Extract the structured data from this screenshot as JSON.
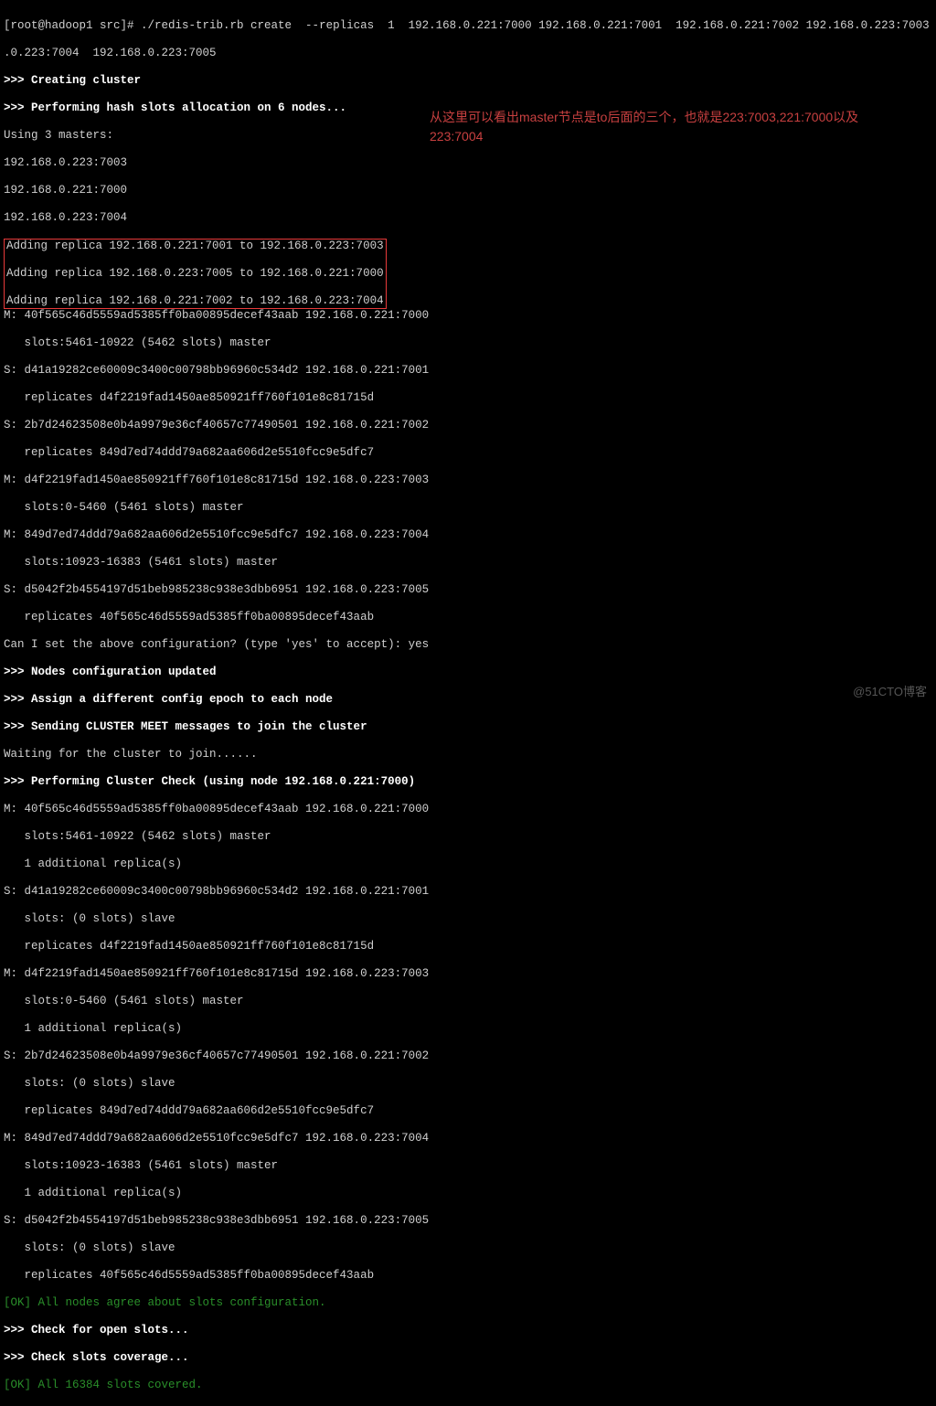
{
  "prompt": "[root@hadoop1 src]# ",
  "command": "./redis-trib.rb create  --replicas  1  192.168.0.221:7000 192.168.0.221:7001  192.168.0.221:7002 192.168.0.223:7003  192.168",
  "command2": ".0.223:7004  192.168.0.223:7005",
  "l_creating": ">>> Creating cluster",
  "l_perform": ">>> Performing hash slots allocation on 6 nodes...",
  "l_using": "Using 3 masters:",
  "l_m1": "192.168.0.223:7003",
  "l_m2": "192.168.0.221:7000",
  "l_m3": "192.168.0.223:7004",
  "box1": "Adding replica 192.168.0.221:7001 to 192.168.0.223:7003",
  "box2": "Adding replica 192.168.0.223:7005 to 192.168.0.221:7000",
  "box3": "Adding replica 192.168.0.221:7002 to 192.168.0.223:7004",
  "n1a": "M: 40f565c46d5559ad5385ff0ba00895decef43aab 192.168.0.221:7000",
  "n1b": "   slots:5461-10922 (5462 slots) master",
  "n2a": "S: d41a19282ce60009c3400c00798bb96960c534d2 192.168.0.221:7001",
  "n2b": "   replicates d4f2219fad1450ae850921ff760f101e8c81715d",
  "n3a": "S: 2b7d24623508e0b4a9979e36cf40657c77490501 192.168.0.221:7002",
  "n3b": "   replicates 849d7ed74ddd79a682aa606d2e5510fcc9e5dfc7",
  "n4a": "M: d4f2219fad1450ae850921ff760f101e8c81715d 192.168.0.223:7003",
  "n4b": "   slots:0-5460 (5461 slots) master",
  "n5a": "M: 849d7ed74ddd79a682aa606d2e5510fcc9e5dfc7 192.168.0.223:7004",
  "n5b": "   slots:10923-16383 (5461 slots) master",
  "n6a": "S: d5042f2b4554197d51beb985238c938e3dbb6951 192.168.0.223:7005",
  "n6b": "   replicates 40f565c46d5559ad5385ff0ba00895decef43aab",
  "l_can": "Can I set the above configuration? (type 'yes' to accept): yes",
  "l_upd": ">>> Nodes configuration updated",
  "l_assign": ">>> Assign a different config epoch to each node",
  "l_send": ">>> Sending CLUSTER MEET messages to join the cluster",
  "l_wait": "Waiting for the cluster to join......",
  "l_check": ">>> Performing Cluster Check (using node 192.168.0.221:7000)",
  "c1a": "M: 40f565c46d5559ad5385ff0ba00895decef43aab 192.168.0.221:7000",
  "c1b": "   slots:5461-10922 (5462 slots) master",
  "c1c": "   1 additional replica(s)",
  "c2a": "S: d41a19282ce60009c3400c00798bb96960c534d2 192.168.0.221:7001",
  "c2b": "   slots: (0 slots) slave",
  "c2c": "   replicates d4f2219fad1450ae850921ff760f101e8c81715d",
  "c3a": "M: d4f2219fad1450ae850921ff760f101e8c81715d 192.168.0.223:7003",
  "c3b": "   slots:0-5460 (5461 slots) master",
  "c3c": "   1 additional replica(s)",
  "c4a": "S: 2b7d24623508e0b4a9979e36cf40657c77490501 192.168.0.221:7002",
  "c4b": "   slots: (0 slots) slave",
  "c4c": "   replicates 849d7ed74ddd79a682aa606d2e5510fcc9e5dfc7",
  "c5a": "M: 849d7ed74ddd79a682aa606d2e5510fcc9e5dfc7 192.168.0.223:7004",
  "c5b": "   slots:10923-16383 (5461 slots) master",
  "c5c": "   1 additional replica(s)",
  "c6a": "S: d5042f2b4554197d51beb985238c938e3dbb6951 192.168.0.223:7005",
  "c6b": "   slots: (0 slots) slave",
  "c6c": "   replicates 40f565c46d5559ad5385ff0ba00895decef43aab",
  "ok1": "[OK] All nodes agree about slots configuration.",
  "l_open": ">>> Check for open slots...",
  "l_cov": ">>> Check slots coverage...",
  "ok2": "[OK] All 16384 slots covered.",
  "annotation2": "从这里可以看出master节点是to后面的三个，也就是223:7003,221:7000以及223:7004",
  "watermark": "@51CTO博客"
}
